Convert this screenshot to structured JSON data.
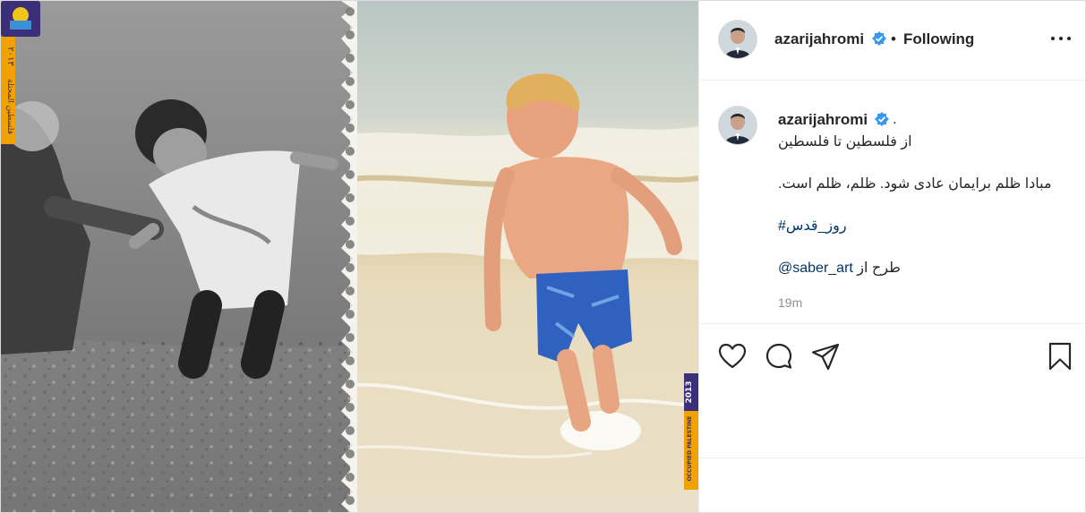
{
  "post": {
    "username": "azarijahromi",
    "separator": "•",
    "follow_label": "Following",
    "caption_dot": ".",
    "caption_lines": [
      "از فلسطین تا فلسطین",
      ".مبادا ظلم برایمان عادی شود. ظلم، ظلم است",
      "#روز_قدس",
      "@saber_art",
      "طرح از"
    ],
    "time_ago": "19m"
  },
  "media": {
    "stamp_year_left": "۲۰۱۳",
    "stamp_text_left": "فلسطين المحتلة",
    "stamp_year_right": "2013",
    "stamp_text_right": "OCCUPIED PALESTINE"
  },
  "colors": {
    "text": "#262626",
    "link": "#00376b",
    "muted": "#8e8e8e",
    "verified": "#3897f0",
    "stamp_orange": "#f0a202",
    "stamp_purple": "#3c2f7a"
  }
}
